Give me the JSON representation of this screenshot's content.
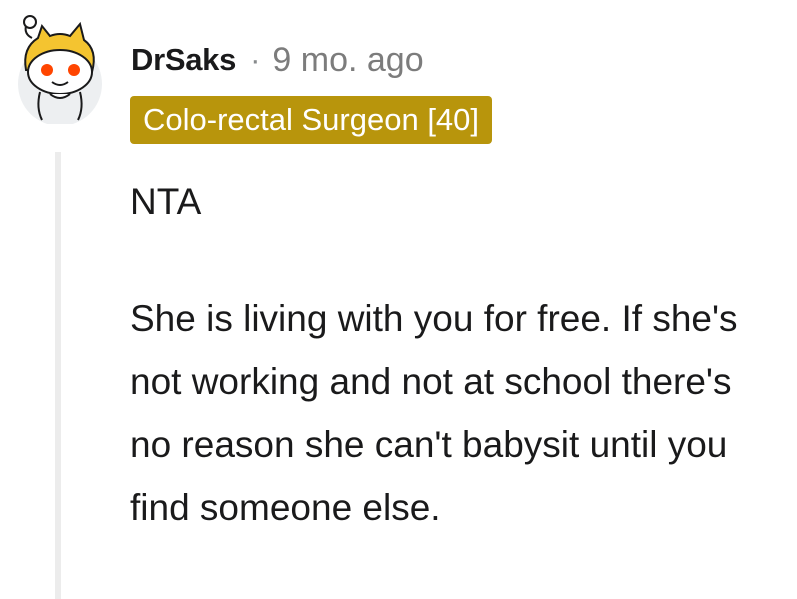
{
  "comment": {
    "author": "DrSaks",
    "separator": "·",
    "timestamp": "9 mo. ago",
    "flair": "Colo-rectal Surgeon [40]",
    "paragraphs": [
      "NTA",
      "She is living with you for free. If she's not working and not at school there's no reason she can't babysit until you find someone else."
    ]
  },
  "avatar": {
    "icon": "snoo-avatar-icon",
    "colors": {
      "hat": "#f4c430",
      "face": "#ffffff",
      "eyes": "#ff4500",
      "outline": "#1a1a1b",
      "background": "#edeff1"
    }
  },
  "colors": {
    "flair_background": "#b8950c",
    "flair_text": "#ffffff",
    "thread_line": "#ececec",
    "meta_text": "#7c7c7c"
  }
}
